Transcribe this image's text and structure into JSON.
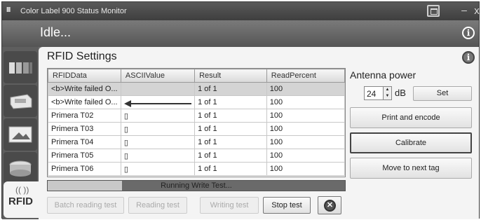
{
  "window": {
    "logo": "III",
    "title": "Color Label 900 Status Monitor",
    "restore_glyph": "",
    "minimize_glyph": "–",
    "close_glyph": "x"
  },
  "status": {
    "text": "Idle...",
    "info_glyph": "i"
  },
  "nav": {
    "items": [
      "printer-icon",
      "cartridge-icon",
      "media-icon",
      "roll-icon"
    ],
    "active": {
      "waves": "(( ))",
      "label": "RFID"
    }
  },
  "panel": {
    "title": "RFID Settings",
    "info_glyph": "i"
  },
  "table": {
    "headers": [
      "RFIDData",
      "ASCIIValue",
      "Result",
      "ReadPercent"
    ],
    "rows": [
      {
        "data": "<b>Write failed O...",
        "ascii": "",
        "result": "1 of 1",
        "percent": "100",
        "selected": true
      },
      {
        "data": "<b>Write failed O...",
        "ascii": "",
        "result": "1 of 1",
        "percent": "100",
        "selected": false
      },
      {
        "data": "Primera T02",
        "ascii": "▯",
        "result": "1 of 1",
        "percent": "100",
        "selected": false
      },
      {
        "data": "Primera T03",
        "ascii": "▯",
        "result": "1 of 1",
        "percent": "100",
        "selected": false
      },
      {
        "data": "Primera T04",
        "ascii": "▯",
        "result": "1 of 1",
        "percent": "100",
        "selected": false
      },
      {
        "data": "Primera T05",
        "ascii": "▯",
        "result": "1 of 1",
        "percent": "100",
        "selected": false
      },
      {
        "data": "Primera T06",
        "ascii": "▯",
        "result": "1 of 1",
        "percent": "100",
        "selected": false
      }
    ]
  },
  "progress": {
    "text": "Running Write Test...",
    "fraction": 0.25
  },
  "buttons": {
    "batch": "Batch reading test",
    "reading": "Reading test",
    "writing": "Writing test",
    "stop": "Stop test",
    "cancel_glyph": "✕"
  },
  "antenna": {
    "label": "Antenna power",
    "value": "24",
    "unit": "dB",
    "set": "Set"
  },
  "actions": {
    "print": "Print and encode",
    "calibrate": "Calibrate",
    "next": "Move to next tag"
  }
}
